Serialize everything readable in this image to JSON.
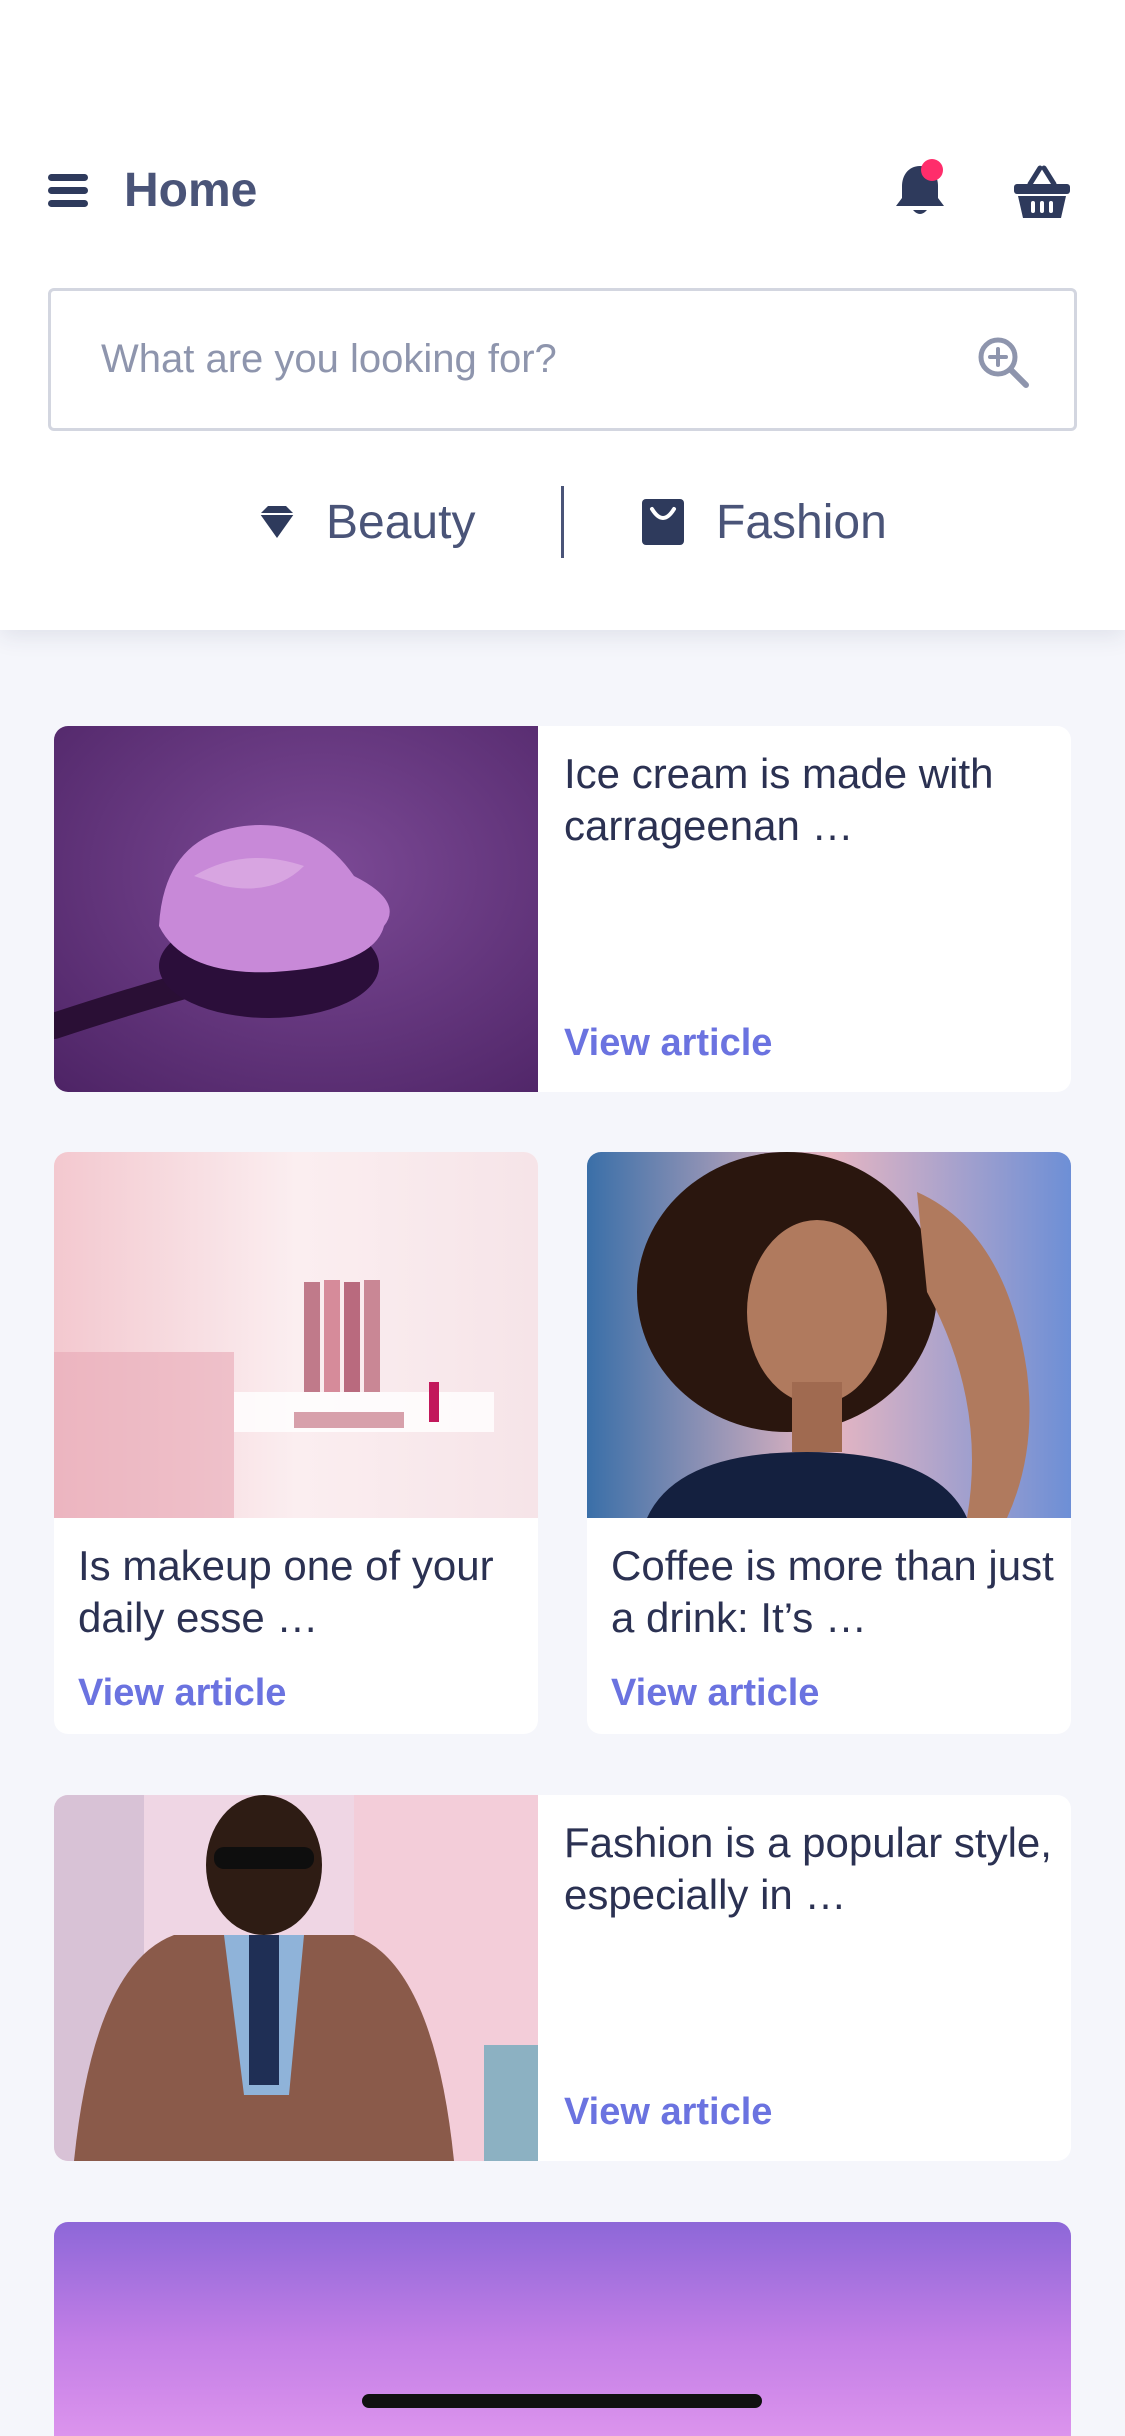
{
  "header": {
    "title": "Home",
    "notification_dot_color": "#ff2d6b",
    "icons": [
      "menu-icon",
      "bell-icon",
      "basket-icon"
    ]
  },
  "search": {
    "placeholder": "What are you looking for?",
    "icon": "search-plus-icon"
  },
  "categories": [
    {
      "label": "Beauty",
      "icon": "diamond-icon"
    },
    {
      "label": "Fashion",
      "icon": "shopping-bag-icon"
    }
  ],
  "articles": [
    {
      "title": "Ice cream is made with carrageenan …",
      "link": "View article"
    },
    {
      "title": "Is makeup one of your daily esse …",
      "link": "View article"
    },
    {
      "title": "Coffee is more than just a drink: It’s …",
      "link": "View article"
    },
    {
      "title": "Fashion is a popular style, especially in …",
      "link": "View article"
    }
  ],
  "colors": {
    "accent": "#6b73e0",
    "text": "#2b3152",
    "background": "#f5f6fb"
  }
}
